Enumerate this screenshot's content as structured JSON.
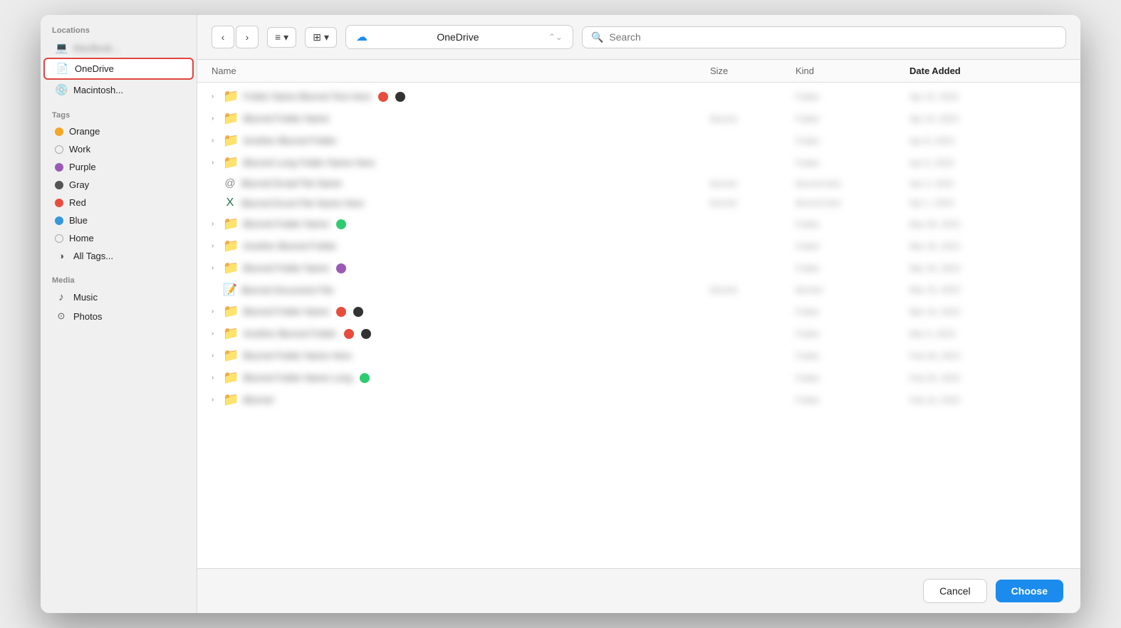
{
  "sidebar": {
    "sections": [
      {
        "label": "Locations",
        "items": [
          {
            "id": "computer",
            "icon": "💻",
            "type": "icon",
            "label": "MacBook...",
            "active": false
          },
          {
            "id": "onedrive",
            "icon": "📄",
            "type": "icon",
            "label": "OneDrive",
            "active": true
          },
          {
            "id": "macintosh",
            "icon": "💿",
            "type": "icon",
            "label": "Macintosh...",
            "active": false
          }
        ]
      },
      {
        "label": "Tags",
        "items": [
          {
            "id": "orange",
            "dotColor": "#f5a623",
            "type": "dot",
            "label": "Orange"
          },
          {
            "id": "work",
            "dotColor": "",
            "type": "dot-empty",
            "label": "Work"
          },
          {
            "id": "purple",
            "dotColor": "#9b59b6",
            "type": "dot",
            "label": "Purple"
          },
          {
            "id": "gray",
            "dotColor": "#555",
            "type": "dot",
            "label": "Gray"
          },
          {
            "id": "red",
            "dotColor": "#e74c3c",
            "type": "dot",
            "label": "Red"
          },
          {
            "id": "blue",
            "dotColor": "#3498db",
            "type": "dot",
            "label": "Blue"
          },
          {
            "id": "home",
            "dotColor": "",
            "type": "dot-empty",
            "label": "Home"
          },
          {
            "id": "all-tags",
            "icon": "◑",
            "type": "icon-text",
            "label": "All Tags..."
          }
        ]
      },
      {
        "label": "Media",
        "items": [
          {
            "id": "music",
            "icon": "♪",
            "type": "icon",
            "label": "Music"
          },
          {
            "id": "photos",
            "icon": "⊙",
            "type": "icon",
            "label": "Photos"
          }
        ]
      }
    ]
  },
  "toolbar": {
    "back_label": "‹",
    "forward_label": "›",
    "list_icon": "≡",
    "grid_icon": "⊞",
    "dropdown_arrow": "▾",
    "location_name": "OneDrive",
    "search_placeholder": "Search"
  },
  "file_list": {
    "columns": [
      "Name",
      "Size",
      "Kind",
      "Date Added"
    ],
    "rows": [
      {
        "type": "folder",
        "name": "blurred_row_1",
        "hasBadgeRed": true,
        "hasBadgeDark": true,
        "size": "",
        "kind": "blurred",
        "date": "blurred"
      },
      {
        "type": "folder",
        "name": "blurred_row_2",
        "hasBadgeRed": false,
        "hasBadgeDark": false,
        "size": "blurred",
        "kind": "blurred",
        "date": "blurred"
      },
      {
        "type": "folder",
        "name": "blurred_row_3",
        "hasBadgeRed": false,
        "hasBadgeDark": false,
        "size": "",
        "kind": "blurred",
        "date": "blurred"
      },
      {
        "type": "folder",
        "name": "blurred_row_4",
        "hasBadgeRed": false,
        "hasBadgeDark": false,
        "size": "",
        "kind": "blurred",
        "date": "blurred"
      },
      {
        "type": "email",
        "name": "blurred_row_5",
        "hasBadgeRed": false,
        "hasBadgeDark": false,
        "size": "blurred",
        "kind": "blurred",
        "date": "blurred"
      },
      {
        "type": "excel",
        "name": "blurred_row_6",
        "hasBadgeRed": false,
        "hasBadgeDark": false,
        "size": "blurred",
        "kind": "blurred",
        "date": "blurred"
      },
      {
        "type": "folder",
        "name": "blurred_row_7",
        "hasBadgeGreen": true,
        "size": "",
        "kind": "blurred",
        "date": "blurred"
      },
      {
        "type": "folder",
        "name": "blurred_row_8",
        "hasBadgeRed": false,
        "hasBadgeDark": false,
        "size": "",
        "kind": "blurred",
        "date": "blurred"
      },
      {
        "type": "folder",
        "name": "blurred_row_9",
        "hasBadgePurple": true,
        "size": "",
        "kind": "blurred",
        "date": "blurred"
      },
      {
        "type": "notepad",
        "name": "blurred_row_10",
        "hasBadgeRed": false,
        "hasBadgeDark": false,
        "size": "blurred",
        "kind": "blurred",
        "date": "blurred"
      },
      {
        "type": "folder",
        "name": "blurred_row_11",
        "hasBadgeRed": true,
        "hasBadgeDark": true,
        "size": "",
        "kind": "blurred",
        "date": "blurred"
      },
      {
        "type": "folder",
        "name": "blurred_row_12",
        "hasBadgeRed": true,
        "hasBadgeDark": true,
        "size": "",
        "kind": "blurred",
        "date": "blurred"
      },
      {
        "type": "folder",
        "name": "blurred_row_13",
        "hasBadgeRed": false,
        "hasBadgeDark": false,
        "size": "",
        "kind": "blurred",
        "date": "blurred"
      },
      {
        "type": "folder",
        "name": "blurred_row_14",
        "hasBadgeGreen": true,
        "size": "",
        "kind": "blurred",
        "date": "blurred"
      },
      {
        "type": "folder",
        "name": "blurred_row_15",
        "hasBadgeRed": false,
        "hasBadgeDark": false,
        "size": "",
        "kind": "blurred",
        "date": "blurred"
      }
    ]
  },
  "buttons": {
    "cancel": "Cancel",
    "choose": "Choose"
  }
}
